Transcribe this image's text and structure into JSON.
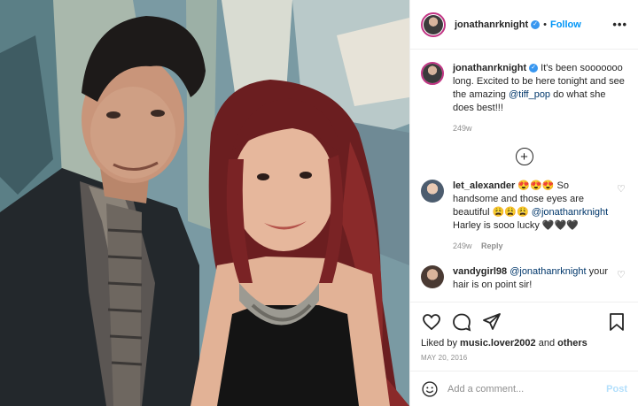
{
  "post": {
    "username": "jonathanrknight",
    "follow_label": "Follow",
    "more_label": "•••"
  },
  "caption": {
    "username": "jonathanrknight",
    "text_before": "It's been sooooooo long. Excited to be here tonight and see the amazing",
    "mention": "@tiff_pop",
    "text_after": "do what she does best!!!",
    "time": "249w"
  },
  "load_more_icon": "plus-circle-icon",
  "comments": [
    {
      "username": "let_alexander",
      "text_a": "😍😍😍 So handsome and those eyes are beautiful 😩😩😩",
      "mention": "@jonathanrknight",
      "text_b": "Harley is sooo lucky 🖤🖤🖤",
      "time": "249w",
      "reply_label": "Reply"
    },
    {
      "username": "vandygirl98",
      "mention": "@jonathanrknight",
      "text_b": "your hair is on point sir!"
    }
  ],
  "likes": {
    "prefix": "Liked by",
    "user": "music.lover2002",
    "mid": "and",
    "others": "others"
  },
  "date": "MAY 20, 2016",
  "add_comment": {
    "placeholder": "Add a comment...",
    "post_label": "Post"
  },
  "colors": {
    "accent": "#0095f6",
    "verified": "#3897f0",
    "muted": "#8e8e8e",
    "post_disabled": "#b2dffc"
  }
}
